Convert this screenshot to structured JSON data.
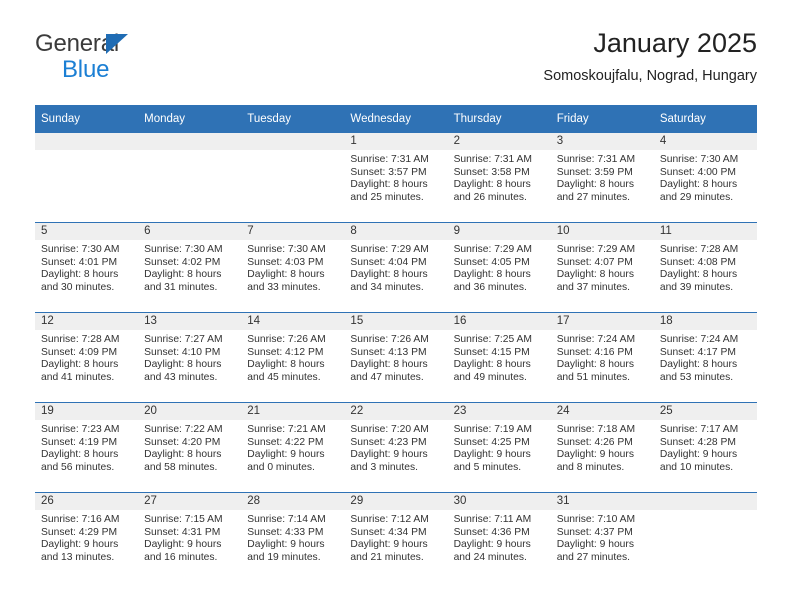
{
  "brand": {
    "word1": "General",
    "word2": "Blue",
    "flag_icon": "blue-triangle-flag-icon",
    "colors": {
      "general": "#3b3b3b",
      "blue": "#1b7fd4",
      "flag": "#1f6cb4"
    }
  },
  "header": {
    "title": "January 2025",
    "location": "Somoskoujfalu, Nograd, Hungary"
  },
  "theme": {
    "header_row_bg": "#2f72b5",
    "header_row_text": "#ffffff",
    "daynum_bg": "#efefef",
    "week_separator": "#2f72b5",
    "body_text": "#333333"
  },
  "weekdays": [
    "Sunday",
    "Monday",
    "Tuesday",
    "Wednesday",
    "Thursday",
    "Friday",
    "Saturday"
  ],
  "weeks": [
    [
      {
        "day": "",
        "sunrise": "",
        "sunset": "",
        "daylight1": "",
        "daylight2": ""
      },
      {
        "day": "",
        "sunrise": "",
        "sunset": "",
        "daylight1": "",
        "daylight2": ""
      },
      {
        "day": "",
        "sunrise": "",
        "sunset": "",
        "daylight1": "",
        "daylight2": ""
      },
      {
        "day": "1",
        "sunrise": "Sunrise: 7:31 AM",
        "sunset": "Sunset: 3:57 PM",
        "daylight1": "Daylight: 8 hours",
        "daylight2": "and 25 minutes."
      },
      {
        "day": "2",
        "sunrise": "Sunrise: 7:31 AM",
        "sunset": "Sunset: 3:58 PM",
        "daylight1": "Daylight: 8 hours",
        "daylight2": "and 26 minutes."
      },
      {
        "day": "3",
        "sunrise": "Sunrise: 7:31 AM",
        "sunset": "Sunset: 3:59 PM",
        "daylight1": "Daylight: 8 hours",
        "daylight2": "and 27 minutes."
      },
      {
        "day": "4",
        "sunrise": "Sunrise: 7:30 AM",
        "sunset": "Sunset: 4:00 PM",
        "daylight1": "Daylight: 8 hours",
        "daylight2": "and 29 minutes."
      }
    ],
    [
      {
        "day": "5",
        "sunrise": "Sunrise: 7:30 AM",
        "sunset": "Sunset: 4:01 PM",
        "daylight1": "Daylight: 8 hours",
        "daylight2": "and 30 minutes."
      },
      {
        "day": "6",
        "sunrise": "Sunrise: 7:30 AM",
        "sunset": "Sunset: 4:02 PM",
        "daylight1": "Daylight: 8 hours",
        "daylight2": "and 31 minutes."
      },
      {
        "day": "7",
        "sunrise": "Sunrise: 7:30 AM",
        "sunset": "Sunset: 4:03 PM",
        "daylight1": "Daylight: 8 hours",
        "daylight2": "and 33 minutes."
      },
      {
        "day": "8",
        "sunrise": "Sunrise: 7:29 AM",
        "sunset": "Sunset: 4:04 PM",
        "daylight1": "Daylight: 8 hours",
        "daylight2": "and 34 minutes."
      },
      {
        "day": "9",
        "sunrise": "Sunrise: 7:29 AM",
        "sunset": "Sunset: 4:05 PM",
        "daylight1": "Daylight: 8 hours",
        "daylight2": "and 36 minutes."
      },
      {
        "day": "10",
        "sunrise": "Sunrise: 7:29 AM",
        "sunset": "Sunset: 4:07 PM",
        "daylight1": "Daylight: 8 hours",
        "daylight2": "and 37 minutes."
      },
      {
        "day": "11",
        "sunrise": "Sunrise: 7:28 AM",
        "sunset": "Sunset: 4:08 PM",
        "daylight1": "Daylight: 8 hours",
        "daylight2": "and 39 minutes."
      }
    ],
    [
      {
        "day": "12",
        "sunrise": "Sunrise: 7:28 AM",
        "sunset": "Sunset: 4:09 PM",
        "daylight1": "Daylight: 8 hours",
        "daylight2": "and 41 minutes."
      },
      {
        "day": "13",
        "sunrise": "Sunrise: 7:27 AM",
        "sunset": "Sunset: 4:10 PM",
        "daylight1": "Daylight: 8 hours",
        "daylight2": "and 43 minutes."
      },
      {
        "day": "14",
        "sunrise": "Sunrise: 7:26 AM",
        "sunset": "Sunset: 4:12 PM",
        "daylight1": "Daylight: 8 hours",
        "daylight2": "and 45 minutes."
      },
      {
        "day": "15",
        "sunrise": "Sunrise: 7:26 AM",
        "sunset": "Sunset: 4:13 PM",
        "daylight1": "Daylight: 8 hours",
        "daylight2": "and 47 minutes."
      },
      {
        "day": "16",
        "sunrise": "Sunrise: 7:25 AM",
        "sunset": "Sunset: 4:15 PM",
        "daylight1": "Daylight: 8 hours",
        "daylight2": "and 49 minutes."
      },
      {
        "day": "17",
        "sunrise": "Sunrise: 7:24 AM",
        "sunset": "Sunset: 4:16 PM",
        "daylight1": "Daylight: 8 hours",
        "daylight2": "and 51 minutes."
      },
      {
        "day": "18",
        "sunrise": "Sunrise: 7:24 AM",
        "sunset": "Sunset: 4:17 PM",
        "daylight1": "Daylight: 8 hours",
        "daylight2": "and 53 minutes."
      }
    ],
    [
      {
        "day": "19",
        "sunrise": "Sunrise: 7:23 AM",
        "sunset": "Sunset: 4:19 PM",
        "daylight1": "Daylight: 8 hours",
        "daylight2": "and 56 minutes."
      },
      {
        "day": "20",
        "sunrise": "Sunrise: 7:22 AM",
        "sunset": "Sunset: 4:20 PM",
        "daylight1": "Daylight: 8 hours",
        "daylight2": "and 58 minutes."
      },
      {
        "day": "21",
        "sunrise": "Sunrise: 7:21 AM",
        "sunset": "Sunset: 4:22 PM",
        "daylight1": "Daylight: 9 hours",
        "daylight2": "and 0 minutes."
      },
      {
        "day": "22",
        "sunrise": "Sunrise: 7:20 AM",
        "sunset": "Sunset: 4:23 PM",
        "daylight1": "Daylight: 9 hours",
        "daylight2": "and 3 minutes."
      },
      {
        "day": "23",
        "sunrise": "Sunrise: 7:19 AM",
        "sunset": "Sunset: 4:25 PM",
        "daylight1": "Daylight: 9 hours",
        "daylight2": "and 5 minutes."
      },
      {
        "day": "24",
        "sunrise": "Sunrise: 7:18 AM",
        "sunset": "Sunset: 4:26 PM",
        "daylight1": "Daylight: 9 hours",
        "daylight2": "and 8 minutes."
      },
      {
        "day": "25",
        "sunrise": "Sunrise: 7:17 AM",
        "sunset": "Sunset: 4:28 PM",
        "daylight1": "Daylight: 9 hours",
        "daylight2": "and 10 minutes."
      }
    ],
    [
      {
        "day": "26",
        "sunrise": "Sunrise: 7:16 AM",
        "sunset": "Sunset: 4:29 PM",
        "daylight1": "Daylight: 9 hours",
        "daylight2": "and 13 minutes."
      },
      {
        "day": "27",
        "sunrise": "Sunrise: 7:15 AM",
        "sunset": "Sunset: 4:31 PM",
        "daylight1": "Daylight: 9 hours",
        "daylight2": "and 16 minutes."
      },
      {
        "day": "28",
        "sunrise": "Sunrise: 7:14 AM",
        "sunset": "Sunset: 4:33 PM",
        "daylight1": "Daylight: 9 hours",
        "daylight2": "and 19 minutes."
      },
      {
        "day": "29",
        "sunrise": "Sunrise: 7:12 AM",
        "sunset": "Sunset: 4:34 PM",
        "daylight1": "Daylight: 9 hours",
        "daylight2": "and 21 minutes."
      },
      {
        "day": "30",
        "sunrise": "Sunrise: 7:11 AM",
        "sunset": "Sunset: 4:36 PM",
        "daylight1": "Daylight: 9 hours",
        "daylight2": "and 24 minutes."
      },
      {
        "day": "31",
        "sunrise": "Sunrise: 7:10 AM",
        "sunset": "Sunset: 4:37 PM",
        "daylight1": "Daylight: 9 hours",
        "daylight2": "and 27 minutes."
      },
      {
        "day": "",
        "sunrise": "",
        "sunset": "",
        "daylight1": "",
        "daylight2": ""
      }
    ]
  ]
}
